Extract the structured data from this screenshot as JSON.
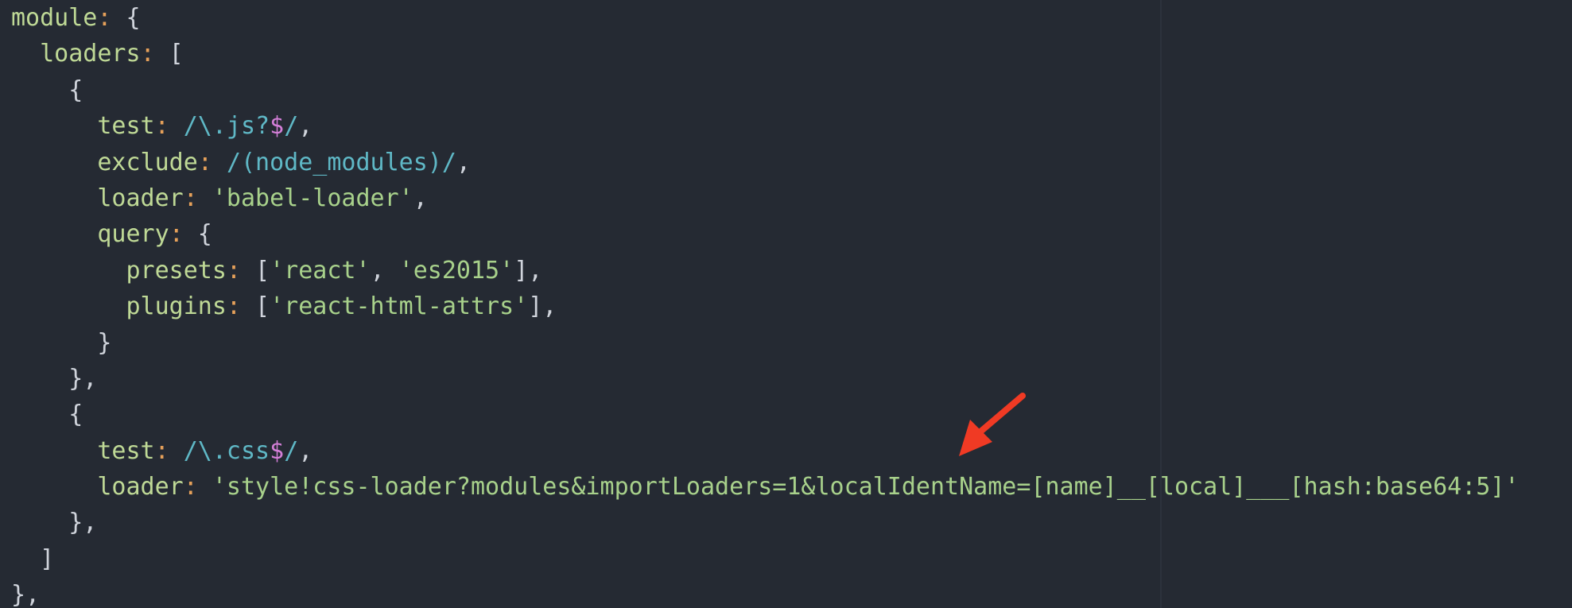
{
  "editor": {
    "lines": {
      "l1": {
        "key": "module",
        "colon": ":",
        "rest": " {"
      },
      "l2": {
        "indent": "  ",
        "key": "loaders",
        "colon": ":",
        "rest": " ["
      },
      "l3": {
        "indent": "    ",
        "rest": "{"
      },
      "l4": {
        "indent": "      ",
        "key": "test",
        "colon": ":",
        "sp": " ",
        "regex_open": "/\\.js?",
        "anchor": "$",
        "regex_close": "/",
        "rest": ","
      },
      "l5": {
        "indent": "      ",
        "key": "exclude",
        "colon": ":",
        "sp": " ",
        "regex": "/(node_modules)/",
        "rest": ","
      },
      "l6": {
        "indent": "      ",
        "key": "loader",
        "colon": ":",
        "sp": " ",
        "string": "'babel-loader'",
        "rest": ","
      },
      "l7": {
        "indent": "      ",
        "key": "query",
        "colon": ":",
        "rest": " {"
      },
      "l8": {
        "indent": "        ",
        "key": "presets",
        "colon": ":",
        "open": " [",
        "s1": "'react'",
        "mid": ", ",
        "s2": "'es2015'",
        "rest": "],"
      },
      "l9": {
        "indent": "        ",
        "key": "plugins",
        "colon": ":",
        "open": " [",
        "s1": "'react-html-attrs'",
        "rest": "],"
      },
      "l10": {
        "indent": "      ",
        "rest": "}"
      },
      "l11": {
        "indent": "    ",
        "rest": "},"
      },
      "l12": {
        "indent": "    ",
        "rest": "{"
      },
      "l13": {
        "indent": "      ",
        "key": "test",
        "colon": ":",
        "sp": " ",
        "regex_open": "/\\.css",
        "anchor": "$",
        "regex_close": "/",
        "rest": ","
      },
      "l14": {
        "indent": "      ",
        "key": "loader",
        "colon": ":",
        "sp": " ",
        "string": "'style!css-loader?modules&importLoaders=1&localIdentName=[name]__[local]___[hash:base64:5]'"
      },
      "l15": {
        "indent": "    ",
        "rest": "},"
      },
      "l16": {
        "indent": "  ",
        "rest": "]"
      },
      "l17": {
        "rest": "},"
      }
    }
  },
  "colors": {
    "background": "#252a33",
    "key": "#bfd996",
    "colon": "#e6a15a",
    "string": "#a8d18b",
    "regex": "#5fb8c6",
    "regex_anchor": "#d47fd8",
    "arrow": "#f03a24"
  },
  "annotation": {
    "icon": "red-arrow-icon"
  }
}
